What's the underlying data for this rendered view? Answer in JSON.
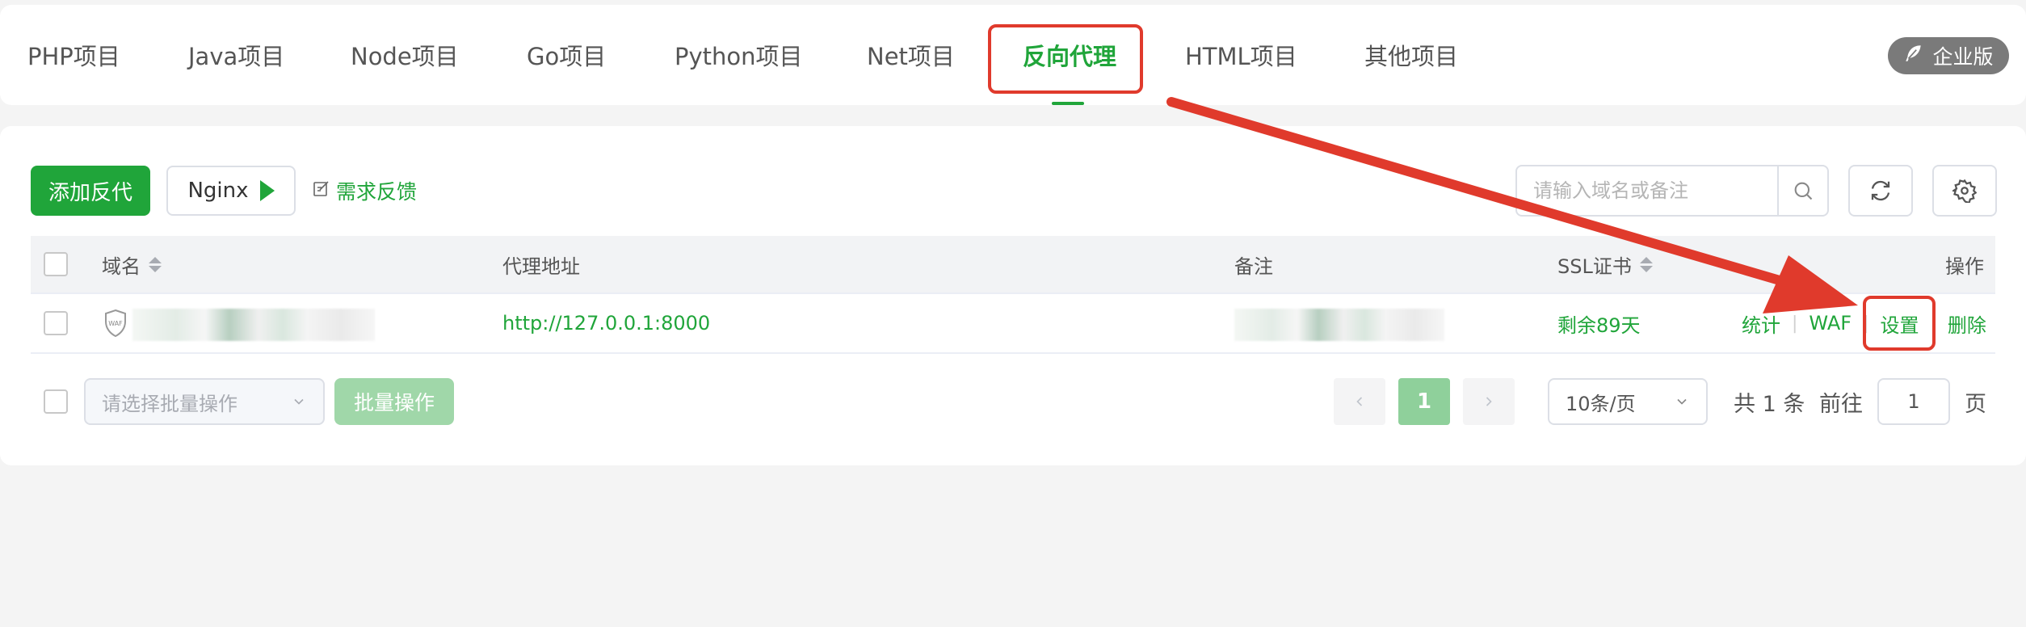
{
  "tabs": [
    {
      "label": "PHP项目"
    },
    {
      "label": "Java项目"
    },
    {
      "label": "Node项目"
    },
    {
      "label": "Go项目"
    },
    {
      "label": "Python项目"
    },
    {
      "label": "Net项目"
    },
    {
      "label": "反向代理",
      "active": true
    },
    {
      "label": "HTML项目"
    },
    {
      "label": "其他项目"
    }
  ],
  "enterprise_label": "企业版",
  "toolbar": {
    "add_label": "添加反代",
    "nginx_label": "Nginx",
    "feedback_label": "需求反馈",
    "search_placeholder": "请输入域名或备注"
  },
  "table": {
    "headers": {
      "domain": "域名",
      "proxy": "代理地址",
      "note": "备注",
      "ssl": "SSL证书",
      "actions": "操作"
    },
    "rows": [
      {
        "domain_badge": "WAF",
        "proxy": "http://127.0.0.1:8000",
        "ssl": "剩余89天",
        "actions": {
          "stats": "统计",
          "waf": "WAF",
          "settings": "设置",
          "delete": "删除"
        }
      }
    ]
  },
  "footer": {
    "bulk_placeholder": "请选择批量操作",
    "bulk_button": "批量操作",
    "current_page": "1",
    "per_page": "10条/页",
    "total_text": "共 1 条",
    "goto_label": "前往",
    "goto_value": "1",
    "page_suffix": "页"
  },
  "colors": {
    "brand_green": "#20a53a",
    "annotation_red": "#e03a2c"
  }
}
